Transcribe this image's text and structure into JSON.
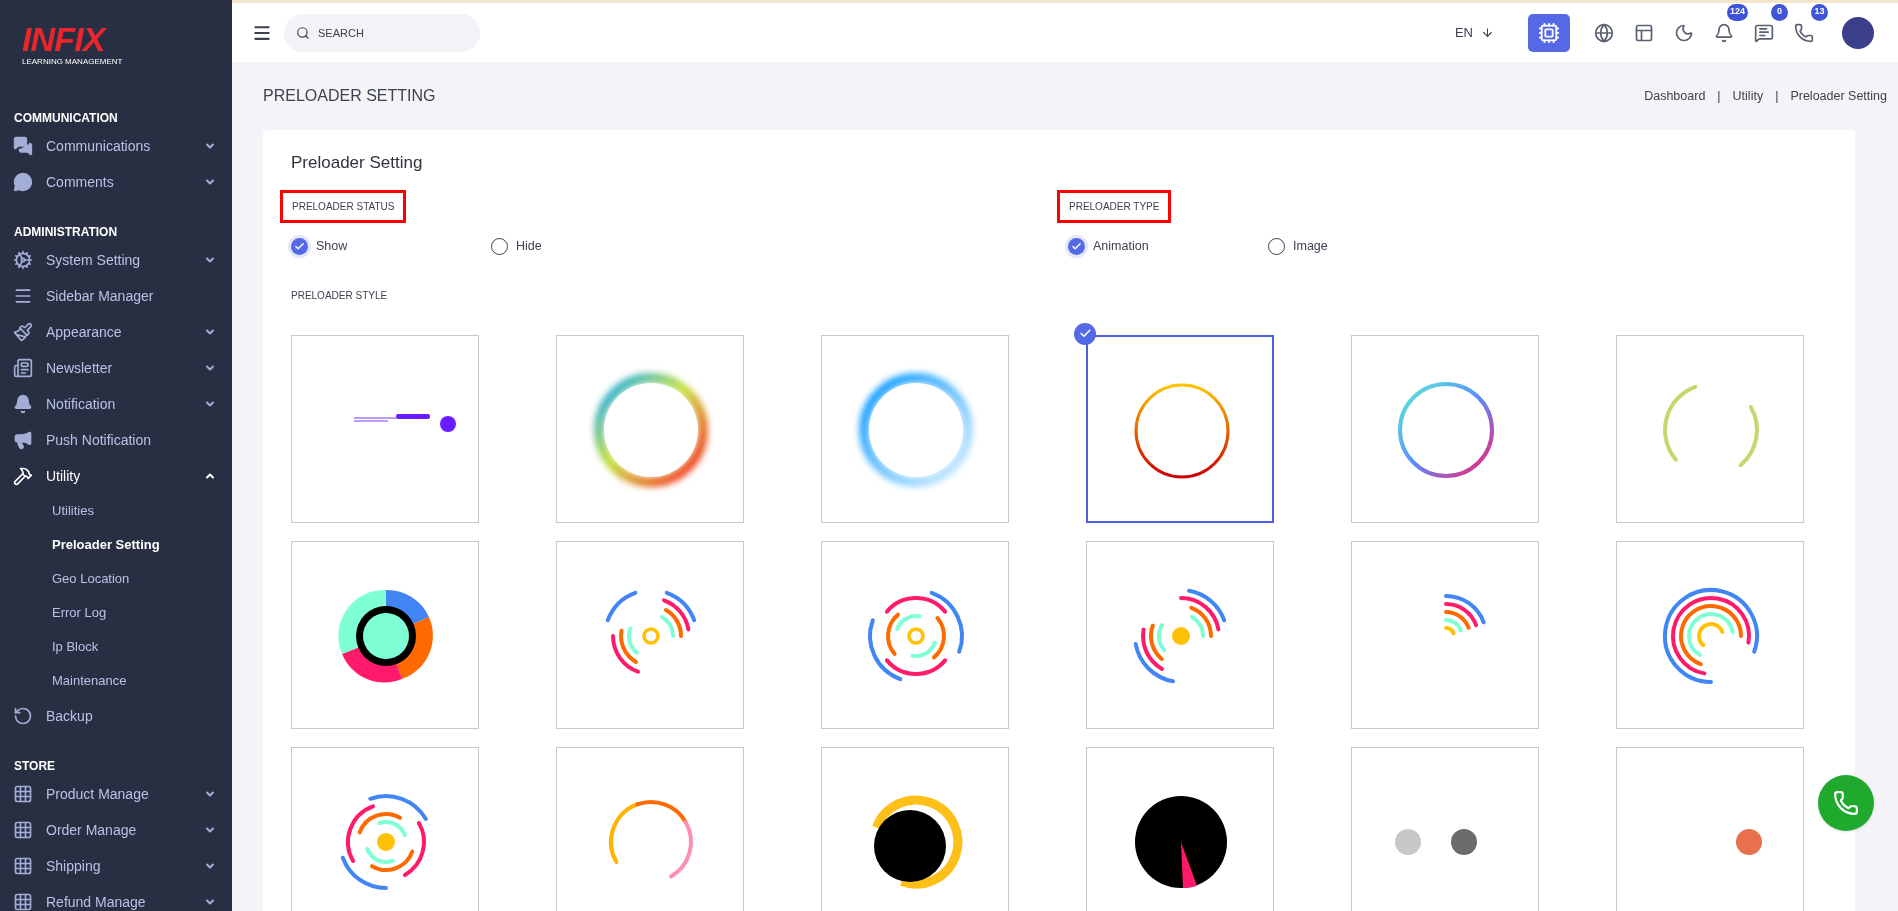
{
  "sidebar": {
    "logo": {
      "brand": "INFIX",
      "tagline": "LEARNING MANAGEMENT"
    },
    "sections": [
      {
        "title": "COMMUNICATION",
        "items": [
          {
            "label": "Communications",
            "expanded": false
          },
          {
            "label": "Comments",
            "expanded": false
          }
        ]
      },
      {
        "title": "ADMINISTRATION",
        "items": [
          {
            "label": "System Setting",
            "expanded": false
          },
          {
            "label": "Sidebar Manager"
          },
          {
            "label": "Appearance",
            "expanded": false
          },
          {
            "label": "Newsletter",
            "expanded": false
          },
          {
            "label": "Notification",
            "expanded": false
          },
          {
            "label": "Push Notification"
          },
          {
            "label": "Utility",
            "expanded": true,
            "children": [
              {
                "label": "Utilities",
                "selected": false
              },
              {
                "label": "Preloader Setting",
                "selected": true
              },
              {
                "label": "Geo Location",
                "selected": false
              },
              {
                "label": "Error Log",
                "selected": false
              },
              {
                "label": "Ip Block",
                "selected": false
              },
              {
                "label": "Maintenance",
                "selected": false
              }
            ]
          },
          {
            "label": "Backup"
          }
        ]
      },
      {
        "title": "STORE",
        "items": [
          {
            "label": "Product Manage",
            "expanded": false
          },
          {
            "label": "Order Manage",
            "expanded": false
          },
          {
            "label": "Shipping",
            "expanded": false
          },
          {
            "label": "Refund Manage",
            "expanded": false
          }
        ]
      }
    ]
  },
  "topbar": {
    "search": {
      "placeholder": "SEARCH"
    },
    "language": "EN",
    "badges": [
      "124",
      "0",
      "13"
    ]
  },
  "page": {
    "title": "PRELOADER SETTING",
    "breadcrumb": [
      {
        "label": "Dashboard"
      },
      {
        "label": "Utility"
      },
      {
        "label": "Preloader Setting"
      }
    ],
    "separator": "|"
  },
  "card": {
    "title": "Preloader Setting",
    "groups": [
      {
        "label": "PRELOADER STATUS",
        "highlighted": true,
        "options": [
          {
            "label": "Show",
            "selected": true
          },
          {
            "label": "Hide",
            "selected": false
          }
        ]
      },
      {
        "label": "PRELOADER TYPE",
        "highlighted": true,
        "options": [
          {
            "label": "Animation",
            "selected": true
          },
          {
            "label": "Image",
            "selected": false
          }
        ]
      }
    ],
    "style_label": "PRELOADER STYLE",
    "styles": [
      {
        "kind": "bar",
        "selected": false
      },
      {
        "kind": "glow-multi",
        "selected": false
      },
      {
        "kind": "glow-blue",
        "selected": false
      },
      {
        "kind": "ring-warm",
        "selected": true
      },
      {
        "kind": "ring-cool",
        "selected": false
      },
      {
        "kind": "dashed",
        "selected": false
      },
      {
        "kind": "donut",
        "selected": false
      },
      {
        "kind": "arcs-split",
        "selected": false
      },
      {
        "kind": "arcs-sides",
        "selected": false
      },
      {
        "kind": "arcs-split-dot",
        "selected": false
      },
      {
        "kind": "arcs-corner",
        "selected": false
      },
      {
        "kind": "arcs-full",
        "selected": false
      },
      {
        "kind": "arcs-spin",
        "selected": false
      },
      {
        "kind": "ring-two-tone",
        "selected": false
      },
      {
        "kind": "dot-ring",
        "selected": false
      },
      {
        "kind": "pie",
        "selected": false
      },
      {
        "kind": "two-dots",
        "selected": false
      },
      {
        "kind": "one-dot",
        "selected": false
      }
    ]
  }
}
